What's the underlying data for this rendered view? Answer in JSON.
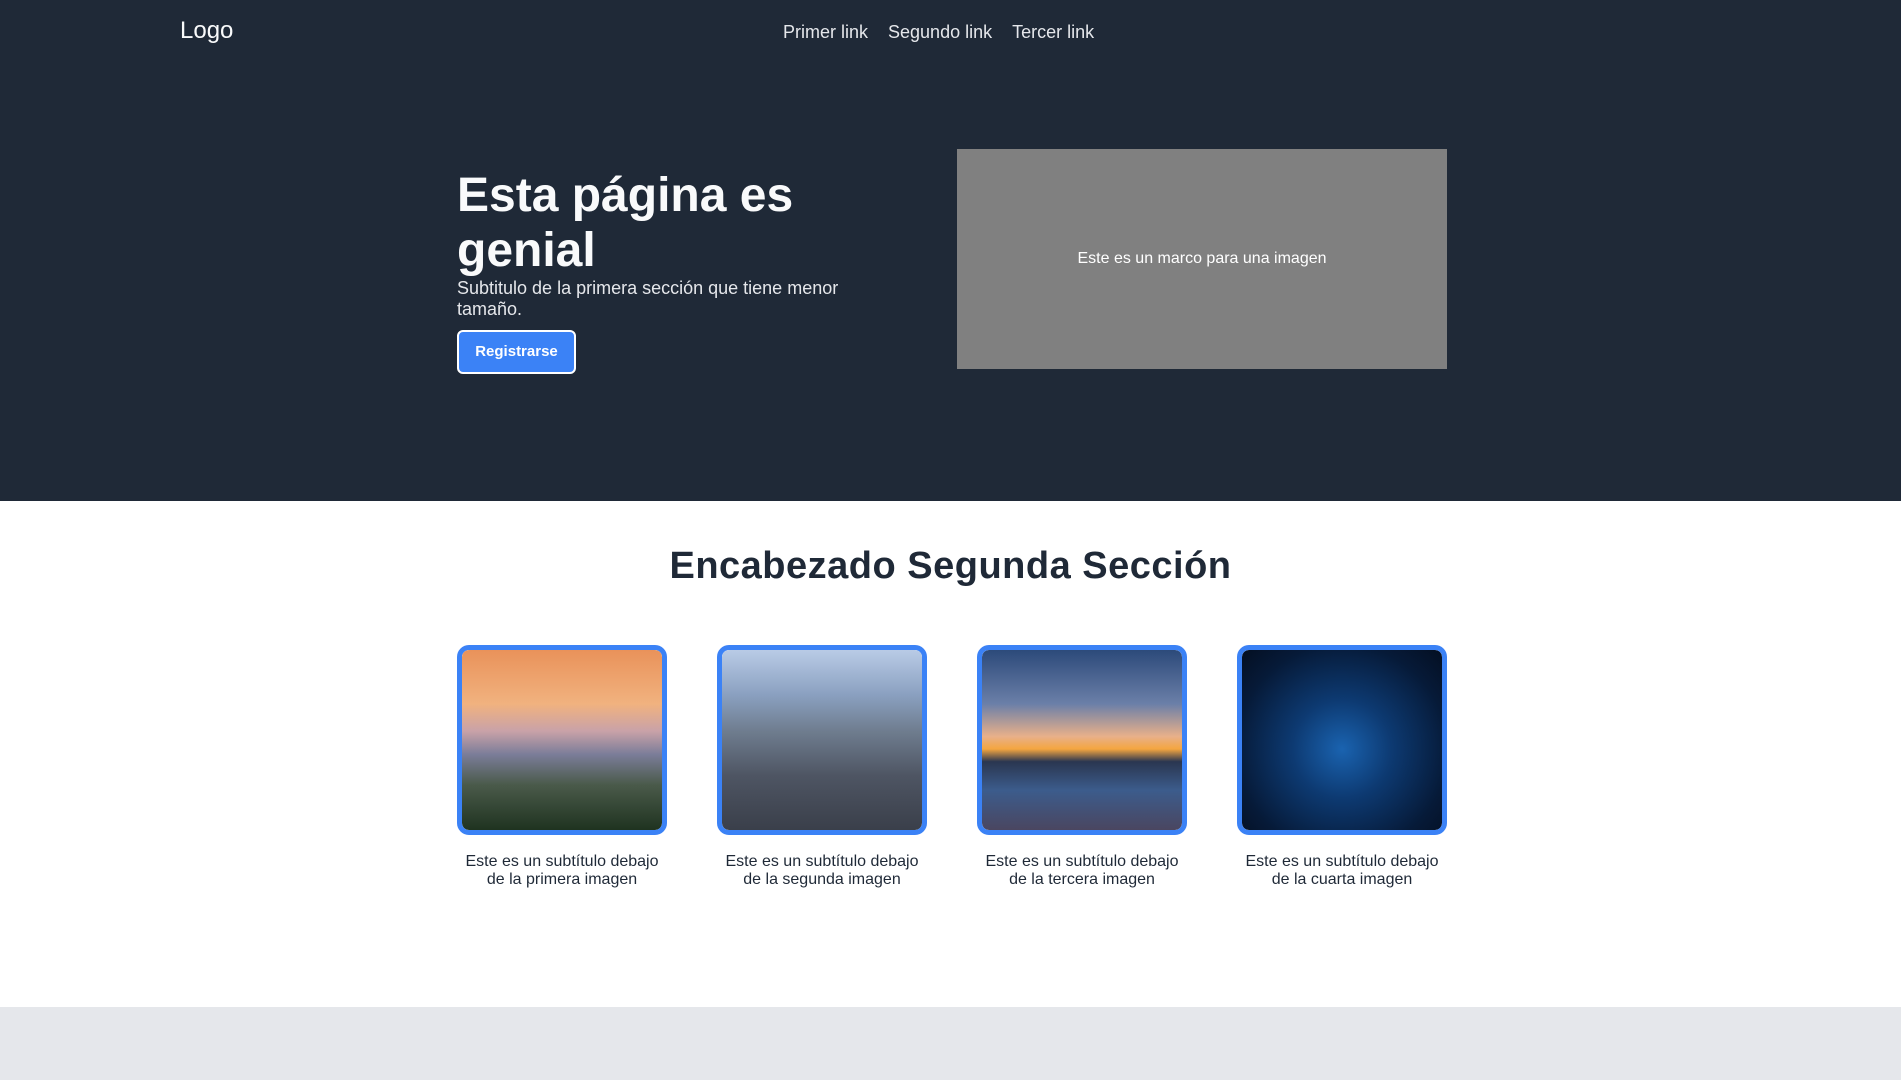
{
  "header": {
    "logo": "Logo",
    "nav": [
      "Primer link",
      "Segundo link",
      "Tercer link"
    ]
  },
  "hero": {
    "title": "Esta página es genial",
    "subtitle": "Subtitulo de la primera sección que tiene menor tamaño.",
    "button": "Registrarse",
    "image_frame": "Este es un marco para una imagen"
  },
  "section2": {
    "heading": "Encabezado Segunda Sección",
    "cards": [
      {
        "caption": "Este es un subtítulo debajo de la primera imagen",
        "image": "mountain-sunset"
      },
      {
        "caption": "Este es un subtítulo debajo de la segunda imagen",
        "image": "city-skyline"
      },
      {
        "caption": "Este es un subtítulo debajo de la tercera imagen",
        "image": "ocean-sunset"
      },
      {
        "caption": "Este es un subtítulo debajo de la cuarta imagen",
        "image": "blue-nebula"
      }
    ]
  },
  "colors": {
    "dark": "#1f2937",
    "accent": "#3b82f6",
    "frame": "#808080",
    "footer": "#e5e7eb"
  }
}
